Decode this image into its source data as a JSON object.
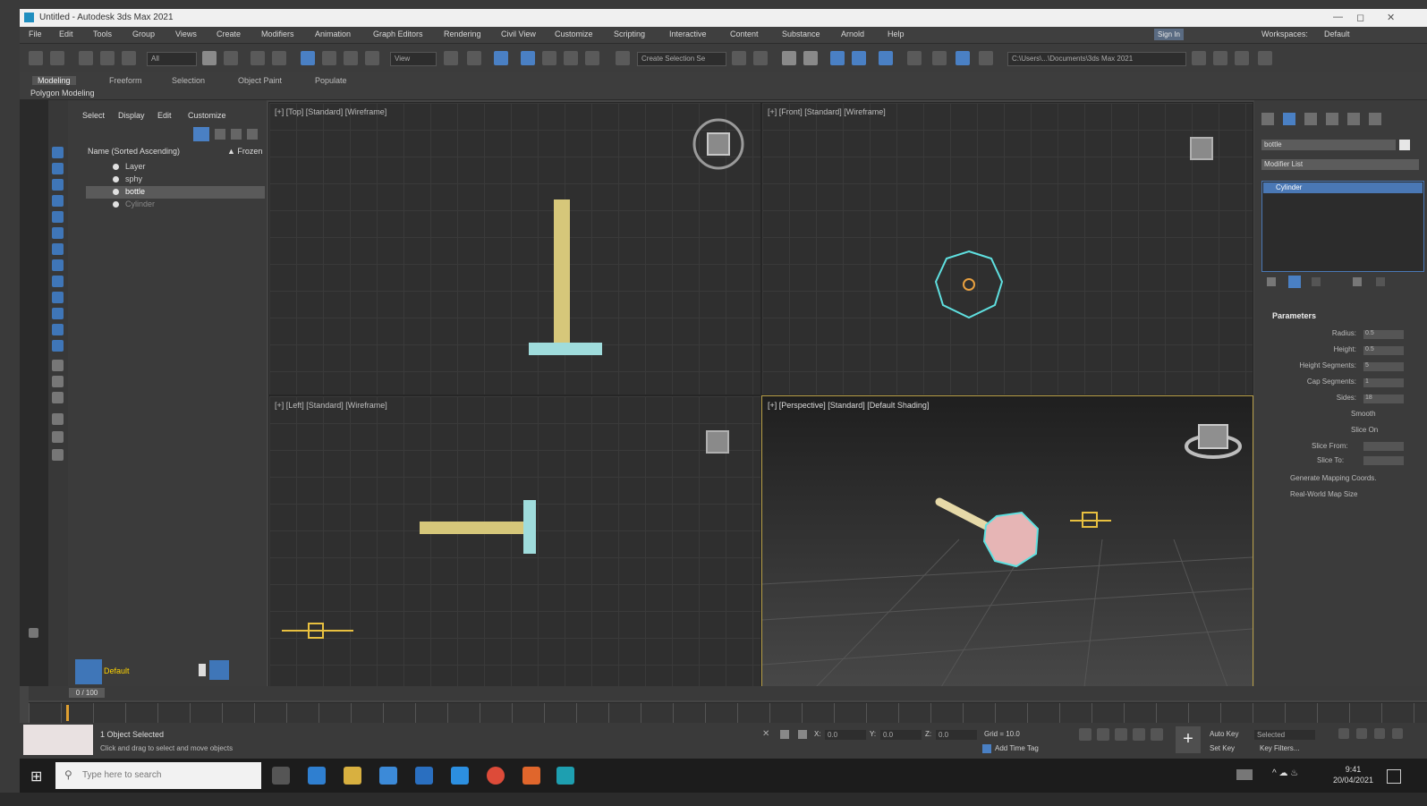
{
  "window": {
    "title": "Untitled - Autodesk 3ds Max 2021"
  },
  "menu": [
    "File",
    "Edit",
    "Tools",
    "Group",
    "Views",
    "Create",
    "Modifiers",
    "Animation",
    "Graph Editors",
    "Rendering",
    "Civil View",
    "Customize",
    "Scripting",
    "Interactive",
    "Content",
    "Substance",
    "Arnold",
    "Help"
  ],
  "workspace": {
    "user_label": "Sign In",
    "workspaces_label": "Workspaces:",
    "workspace_value": "Default"
  },
  "toolbar": {
    "filter_value": "All",
    "view_value": "View",
    "selection_set_placeholder": "Create Selection Se",
    "path_value": "C:\\Users\\...\\Documents\\3ds Max 2021"
  },
  "ribbon": {
    "tabs": [
      "Modeling",
      "Freeform",
      "Selection",
      "Object Paint",
      "Populate"
    ],
    "sub": "Polygon Modeling"
  },
  "scene_explorer": {
    "tabs": [
      "Select",
      "Display",
      "Edit",
      "Customize"
    ],
    "header_name": "Name (Sorted Ascending)",
    "header_frozen": "▲ Frozen",
    "rows": [
      {
        "name": "Layer",
        "selected": false
      },
      {
        "name": "sphy",
        "selected": false
      },
      {
        "name": "bottle",
        "selected": true
      },
      {
        "name": "Cylinder",
        "selected": false
      }
    ],
    "layer_label": "Default"
  },
  "viewports": [
    {
      "label": "[+] [Top] [Standard] [Wireframe]"
    },
    {
      "label": "[+] [Front] [Standard] [Wireframe]"
    },
    {
      "label": "[+] [Left] [Standard] [Wireframe]"
    },
    {
      "label": "[+] [Perspective] [Standard] [Default Shading]"
    }
  ],
  "command_panel": {
    "object_name": "bottle",
    "modifier_list": "Modifier List",
    "stack_item": "Cylinder",
    "rollout": "Parameters",
    "params": [
      {
        "label": "Radius:",
        "value": "0.5"
      },
      {
        "label": "Height:",
        "value": "0.5"
      },
      {
        "label": "Height Segments:",
        "value": "5"
      },
      {
        "label": "Cap Segments:",
        "value": "1"
      },
      {
        "label": "Sides:",
        "value": "18"
      }
    ],
    "smooth_label": "Smooth",
    "slice_on": "Slice On",
    "slice_from": "Slice From:",
    "slice_to": "Slice To:",
    "gen_mapping": "Generate Mapping Coords.",
    "real_world": "Real-World Map Size"
  },
  "timeline": {
    "frame_display": "0 / 100"
  },
  "status": {
    "line1": "1 Object Selected",
    "line2": "Click and drag to select and move objects",
    "x_label": "X:",
    "x_value": "0.0",
    "y_label": "Y:",
    "y_value": "0.0",
    "z_label": "Z:",
    "z_value": "0.0",
    "grid": "Grid = 10.0",
    "add_time_tag": "Add Time Tag",
    "autokey": "Auto Key",
    "selected": "Selected",
    "setkey": "Set Key",
    "key_filters": "Key Filters..."
  },
  "taskbar": {
    "search_placeholder": "Type here to search",
    "time": "9:41",
    "date": "20/04/2021"
  },
  "colors": {
    "accent": "#4a80c4",
    "selection_wire": "#5fe0e0",
    "object_yellow": "#d6c77a",
    "persp_border": "#b8a048"
  }
}
